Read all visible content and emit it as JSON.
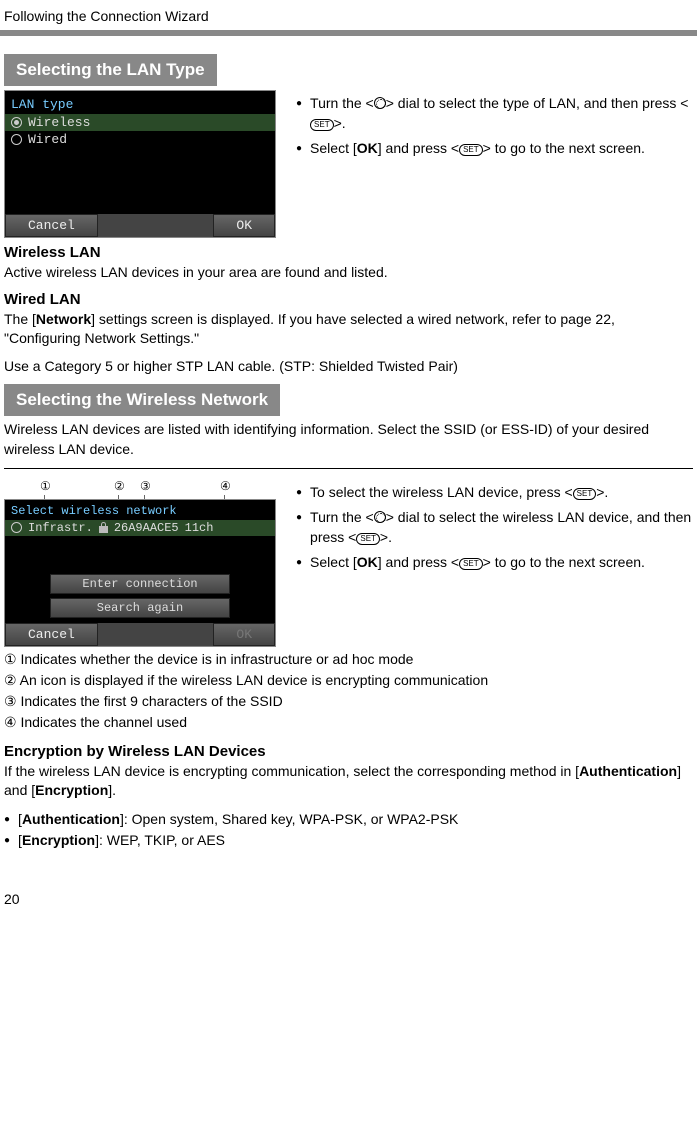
{
  "page_header": "Following the Connection Wizard",
  "page_number": "20",
  "section1": {
    "heading": "Selecting the LAN Type",
    "screenshot": {
      "title": "LAN type",
      "opt1": "Wireless",
      "opt2": "Wired",
      "cancel": "Cancel",
      "ok": "OK"
    },
    "bullets": {
      "b1a": "Turn the <",
      "b1b": "> dial to select the type of LAN, and then press <",
      "b1c": ">.",
      "b2a": "Select [",
      "b2b": "OK",
      "b2c": "] and press <",
      "b2d": "> to go to the next screen."
    }
  },
  "wireless_lan": {
    "heading": "Wireless LAN",
    "text": "Active wireless LAN devices in your area are found and listed."
  },
  "wired_lan": {
    "heading": "Wired LAN",
    "text1a": "The [",
    "text1b": "Network",
    "text1c": "] settings screen is displayed. If you have selected a wired network, refer to page 22, \"Configuring Network Settings.\"",
    "text2": "Use a Category 5 or higher STP LAN cable. (STP: Shielded Twisted Pair)"
  },
  "section2": {
    "heading": "Selecting the Wireless Network",
    "intro": "Wireless LAN devices are listed with identifying information. Select the SSID (or ESS-ID) of your desired wireless LAN device.",
    "callouts": {
      "c1": "①",
      "c2": "②",
      "c3": "③",
      "c4": "④"
    },
    "screenshot": {
      "title": "Select wireless network",
      "mode": "Infrastr.",
      "ssid": "26A9AACE5",
      "channel": "11ch",
      "enter": "Enter connection",
      "search": "Search again",
      "cancel": "Cancel",
      "ok": "OK"
    },
    "bullets": {
      "b1a": "To select the wireless LAN device, press <",
      "b1b": ">.",
      "b2a": "Turn the <",
      "b2b": "> dial to select the wireless LAN device, and then press <",
      "b2c": ">.",
      "b3a": "Select [",
      "b3b": "OK",
      "b3c": "] and press <",
      "b3d": "> to go to the next screen."
    },
    "legend": {
      "l1": "① Indicates whether the device is in infrastructure or ad hoc mode",
      "l2": "② An icon is displayed if the wireless LAN device is encrypting communication",
      "l3": "③ Indicates the first 9 characters of the SSID",
      "l4": "④ Indicates the channel used"
    }
  },
  "encryption": {
    "heading": "Encryption by Wireless LAN Devices",
    "text1a": "If the wireless LAN device is encrypting communication, select the corresponding method in [",
    "text1b": "Authentication",
    "text1c": "] and [",
    "text1d": "Encryption",
    "text1e": "].",
    "b1a": "[",
    "b1b": "Authentication",
    "b1c": "]: Open system, Shared key, WPA-PSK, or WPA2-PSK",
    "b2a": "[",
    "b2b": "Encryption",
    "b2c": "]: WEP, TKIP, or AES"
  }
}
